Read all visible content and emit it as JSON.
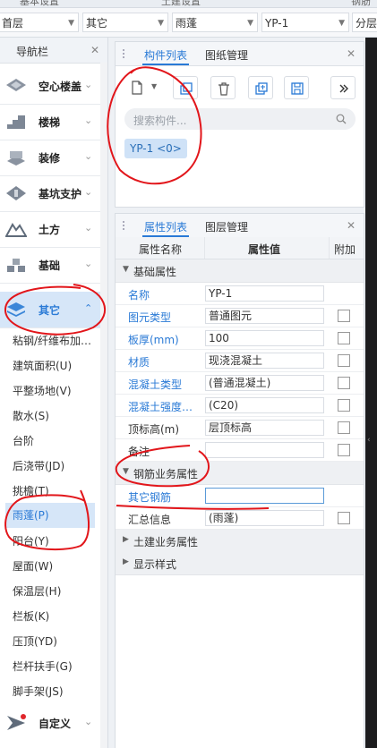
{
  "top_strip": {
    "tab_left": "基本设置",
    "tab_mid": "土建设置",
    "tab_right": "钢筋"
  },
  "filters": {
    "floor": "首层",
    "category": "其它",
    "type": "雨蓬",
    "component": "YP-1",
    "layer": "分层"
  },
  "nav": {
    "title": "导航栏",
    "categories": [
      {
        "label": "空心楼盖",
        "icon": "hollow-floor-icon"
      },
      {
        "label": "楼梯",
        "icon": "stairs-icon"
      },
      {
        "label": "装修",
        "icon": "decoration-icon"
      },
      {
        "label": "基坑支护",
        "icon": "pit-support-icon"
      },
      {
        "label": "土方",
        "icon": "earthwork-icon"
      },
      {
        "label": "基础",
        "icon": "foundation-icon"
      },
      {
        "label": "其它",
        "icon": "other-icon"
      }
    ],
    "subitems": [
      "粘钢/纤维布加…",
      "建筑面积(U)",
      "平整场地(V)",
      "散水(S)",
      "台阶",
      "后浇带(JD)",
      "挑檐(T)",
      "雨蓬(P)",
      "阳台(Y)",
      "屋面(W)",
      "保温层(H)",
      "栏板(K)",
      "压顶(YD)",
      "栏杆扶手(G)",
      "脚手架(JS)"
    ],
    "custom": "自定义"
  },
  "component_panel": {
    "tab_active": "构件列表",
    "tab_other": "图纸管理",
    "search_placeholder": "搜索构件...",
    "items": [
      "YP-1 <0>"
    ]
  },
  "property_panel": {
    "tab_active": "属性列表",
    "tab_other": "图层管理",
    "headers": {
      "name": "属性名称",
      "value": "属性值",
      "extra": "附加"
    },
    "section_basic": "基础属性",
    "rows": [
      {
        "name": "名称",
        "value": "YP-1",
        "blue": true
      },
      {
        "name": "图元类型",
        "value": "普通图元",
        "blue": true
      },
      {
        "name": "板厚(mm)",
        "value": "100",
        "blue": true
      },
      {
        "name": "材质",
        "value": "现浇混凝土",
        "blue": true
      },
      {
        "name": "混凝土类型",
        "value": "(普通混凝土)",
        "blue": true
      },
      {
        "name": "混凝土强度…",
        "value": "(C20)",
        "blue": true
      },
      {
        "name": "顶标高(m)",
        "value": "层顶标高",
        "blue": false
      },
      {
        "name": "备注",
        "value": "",
        "blue": false
      }
    ],
    "section_rebar": "钢筋业务属性",
    "rebar_rows": [
      {
        "name": "其它钢筋",
        "value": "",
        "blue": true
      }
    ],
    "summary": {
      "name": "汇总信息",
      "value": "(雨蓬)"
    },
    "section_civil": "土建业务属性",
    "section_display": "显示样式"
  }
}
